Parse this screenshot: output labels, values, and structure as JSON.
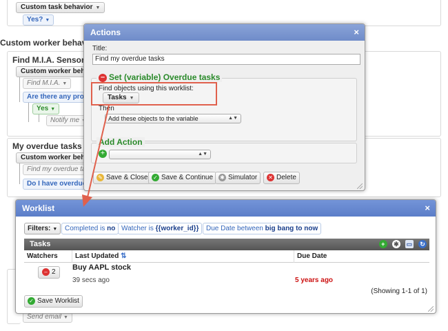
{
  "background": {
    "custom_task_behavior": "Custom task behavior",
    "yes_top": "Yes?",
    "custom_worker_behavior_heading": "Custom worker behavi",
    "find_mia_heading": "Find M.I.A. Sensor",
    "custom_worker_behavior_chip": "Custom worker behavi",
    "find_mia_chip": "Find M.I.A.",
    "are_there_any": "Are there any pro",
    "yes_chip": "Yes",
    "notify_me": "Notify me",
    "my_overdue_heading": "My overdue tasks",
    "custom_worker_behavior_chip2": "Custom worker behavi",
    "find_my_overdue": "Find my overdue ta",
    "do_i_have_overdue": "Do I have overdue",
    "send_email": "Send email"
  },
  "actions_dialog": {
    "title": "Actions",
    "close_label": "×",
    "title_field_label": "Title:",
    "title_value": "Find my overdue tasks",
    "set_variable_legend": "Set (variable) Overdue tasks",
    "find_objects_label": "Find objects using this worklist:",
    "tasks_select": "Tasks",
    "then_label": "Then",
    "then_select": "Add these objects to the variable",
    "add_action_legend": "Add Action",
    "add_action_select": "",
    "buttons": {
      "save_close": "Save & Close",
      "save_continue": "Save & Continue",
      "simulator": "Simulator",
      "delete": "Delete"
    }
  },
  "worklist": {
    "title": "Worklist",
    "close_label": "×",
    "filters_label": "Filters:",
    "filter_completed_prefix": "Completed is",
    "filter_completed_value": "no",
    "filter_watcher_prefix": "Watcher is",
    "filter_watcher_value": "{{worker_id}}",
    "filter_due_prefix": "Due Date between",
    "filter_due_value": "big bang to now",
    "tasks_header": "Tasks",
    "columns": {
      "watchers": "Watchers",
      "last_updated": "Last Updated",
      "due_date": "Due Date"
    },
    "rows": [
      {
        "watchers_count": "2",
        "name": "Buy AAPL stock",
        "last_updated": "39 secs ago",
        "due_date": "5 years ago"
      }
    ],
    "showing": "(Showing 1-1 of 1)",
    "save_worklist": "Save Worklist"
  },
  "colors": {
    "dialog_title_bar": "#7f9ad2",
    "highlight_border": "#e0604c",
    "overdue_red": "#cc1111",
    "legend_green": "#2a8a2a"
  }
}
